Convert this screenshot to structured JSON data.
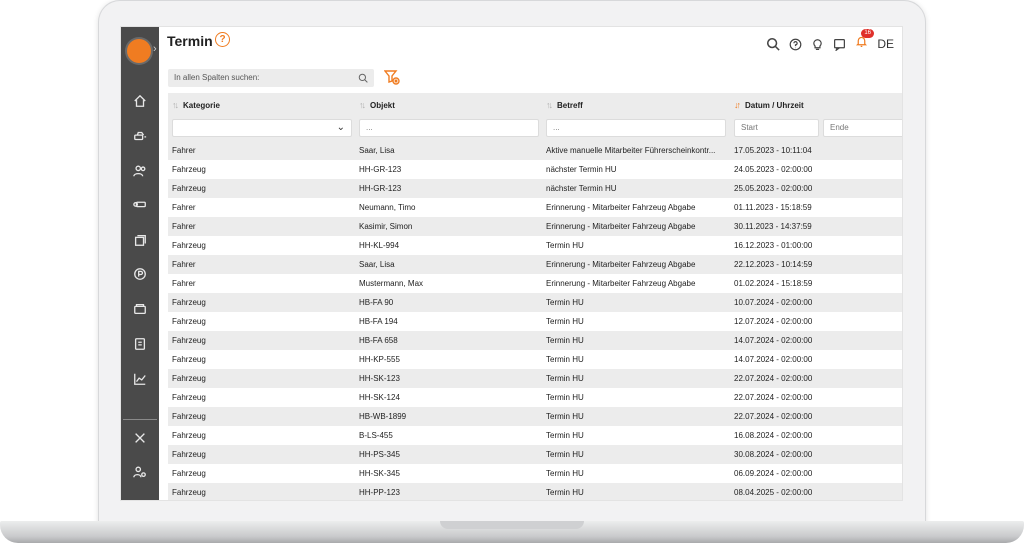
{
  "header": {
    "title": "Termin",
    "help_glyph": "?",
    "language": "DE",
    "notification_count": "16"
  },
  "search": {
    "placeholder": "In allen Spalten suchen:"
  },
  "table": {
    "columns": [
      {
        "label": "Kategorie"
      },
      {
        "label": "Objekt"
      },
      {
        "label": "Betreff"
      },
      {
        "label": "Datum / Uhrzeit"
      }
    ],
    "filters": {
      "objekt": "...",
      "betreff": "...",
      "start": "Start",
      "ende": "Ende"
    },
    "rows": [
      [
        "Fahrer",
        "Saar, Lisa",
        "Aktive manuelle Mitarbeiter Führerscheinkontr...",
        "17.05.2023 - 10:11:04"
      ],
      [
        "Fahrzeug",
        "HH-GR-123",
        "nächster Termin HU",
        "24.05.2023 - 02:00:00"
      ],
      [
        "Fahrzeug",
        "HH-GR-123",
        "nächster Termin HU",
        "25.05.2023 - 02:00:00"
      ],
      [
        "Fahrer",
        "Neumann, Timo",
        "Erinnerung - Mitarbeiter Fahrzeug Abgabe",
        "01.11.2023 - 15:18:59"
      ],
      [
        "Fahrer",
        "Kasimir, Simon",
        "Erinnerung - Mitarbeiter Fahrzeug Abgabe",
        "30.11.2023 - 14:37:59"
      ],
      [
        "Fahrzeug",
        "HH-KL-994",
        "Termin HU",
        "16.12.2023 - 01:00:00"
      ],
      [
        "Fahrer",
        "Saar, Lisa",
        "Erinnerung - Mitarbeiter Fahrzeug Abgabe",
        "22.12.2023 - 10:14:59"
      ],
      [
        "Fahrer",
        "Mustermann, Max",
        "Erinnerung - Mitarbeiter Fahrzeug Abgabe",
        "01.02.2024 - 15:18:59"
      ],
      [
        "Fahrzeug",
        "HB-FA 90",
        "Termin HU",
        "10.07.2024 - 02:00:00"
      ],
      [
        "Fahrzeug",
        "HB-FA 194",
        "Termin HU",
        "12.07.2024 - 02:00:00"
      ],
      [
        "Fahrzeug",
        "HB-FA 658",
        "Termin HU",
        "14.07.2024 - 02:00:00"
      ],
      [
        "Fahrzeug",
        "HH-KP-555",
        "Termin HU",
        "14.07.2024 - 02:00:00"
      ],
      [
        "Fahrzeug",
        "HH-SK-123",
        "Termin HU",
        "22.07.2024 - 02:00:00"
      ],
      [
        "Fahrzeug",
        "HH-SK-124",
        "Termin HU",
        "22.07.2024 - 02:00:00"
      ],
      [
        "Fahrzeug",
        "HB-WB-1899",
        "Termin HU",
        "22.07.2024 - 02:00:00"
      ],
      [
        "Fahrzeug",
        "B-LS-455",
        "Termin HU",
        "16.08.2024 - 02:00:00"
      ],
      [
        "Fahrzeug",
        "HH-PS-345",
        "Termin HU",
        "30.08.2024 - 02:00:00"
      ],
      [
        "Fahrzeug",
        "HH-SK-345",
        "Termin HU",
        "06.09.2024 - 02:00:00"
      ],
      [
        "Fahrzeug",
        "HH-PP-123",
        "Termin HU",
        "08.04.2025 - 02:00:00"
      ]
    ]
  },
  "icons": {
    "sidebar": [
      "home-icon",
      "cars-icon",
      "users-icon",
      "car-key-icon",
      "layers-icon",
      "parking-icon",
      "wallet-icon",
      "document-icon",
      "chart-icon",
      "tools-icon",
      "user-settings-icon"
    ],
    "header": [
      "search-icon",
      "help-icon",
      "lightbulb-icon",
      "feedback-icon",
      "bell-icon"
    ]
  },
  "colors": {
    "accent": "#f07c21",
    "sidebar": "#4a4a4a",
    "badge": "#e0312b"
  }
}
